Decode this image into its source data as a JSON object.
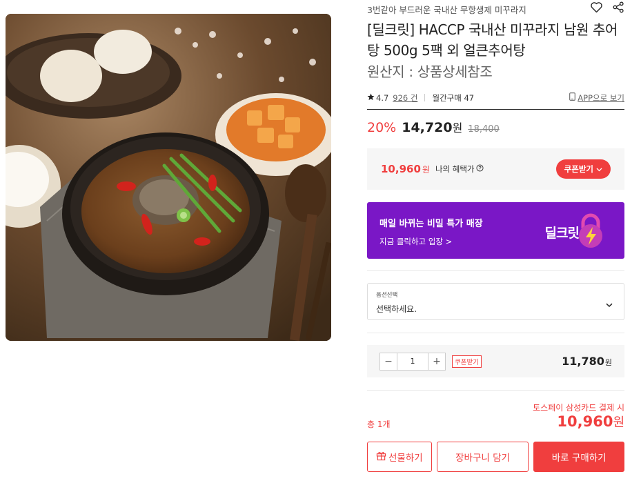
{
  "product": {
    "subtitle": "3번같아 부드러운 국내산 무항생제 미꾸라지",
    "title": "[딜크릿] HACCP 국내산 미꾸라지 남원 추어탕 500g 5팩 외 얼큰추어탕",
    "origin": "원산지 : 상품상세참조",
    "image_alt": "추어탕"
  },
  "icons": {
    "wishlist": "heart-icon",
    "share": "share-icon",
    "star": "star-icon",
    "phone": "phone-icon",
    "info": "info-icon"
  },
  "rating": {
    "score": "4.7",
    "review_count": "926 건",
    "monthly": "월간구매 47",
    "app_link": "APP으로 보기"
  },
  "pricing": {
    "discount": "20%",
    "price": "14,720",
    "won": "원",
    "original": "18,400"
  },
  "benefit": {
    "price": "10,960",
    "won": "원",
    "label": "나의 혜택가",
    "coupon_button": "쿠폰받기"
  },
  "banner": {
    "title": "매일 바뀌는 비밀 특가 매장",
    "subtitle": "지금 클릭하고 입장 >",
    "logo": "딜크릿"
  },
  "option": {
    "label": "옵션선택",
    "placeholder": "선택하세요."
  },
  "quantity": {
    "minus": "−",
    "value": "1",
    "plus": "+",
    "coupon_label": "쿠폰받기",
    "price": "11,780",
    "won": "원"
  },
  "total": {
    "promo": "토스페이 삼성카드 결제 시",
    "label": "총 1개",
    "price": "10,960",
    "won": "원"
  },
  "buttons": {
    "gift": "선물하기",
    "cart": "장바구니 담기",
    "buy": "바로 구매하기"
  },
  "colors": {
    "accent": "#f03e3e",
    "banner": "#7a17c6"
  }
}
